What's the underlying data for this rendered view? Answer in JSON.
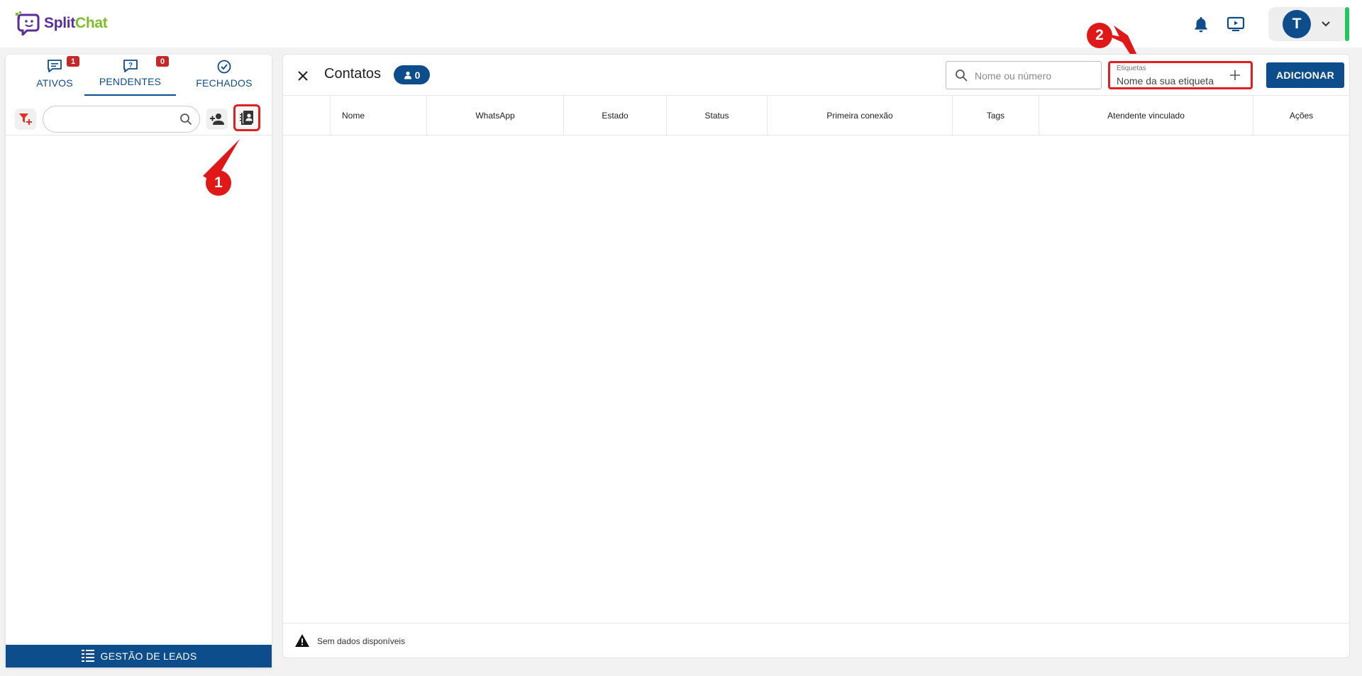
{
  "app": {
    "logo_split": "Split",
    "logo_chat": "Chat"
  },
  "header": {
    "user_initial": "T"
  },
  "sidebar": {
    "tabs": [
      {
        "label": "ATIVOS",
        "badge": "1"
      },
      {
        "label": "PENDENTES",
        "badge": "0"
      },
      {
        "label": "FECHADOS"
      }
    ],
    "leads_label": "GESTÃO DE LEADS"
  },
  "markers": {
    "one": "1",
    "two": "2"
  },
  "contacts": {
    "title": "Contatos",
    "count": "0",
    "search_placeholder": "Nome ou número",
    "tag_label": "Etiquetas",
    "tag_placeholder": "Nome da sua etiqueta",
    "add_label": "ADICIONAR",
    "columns": [
      "Nome",
      "WhatsApp",
      "Estado",
      "Status",
      "Primeira conexão",
      "Tags",
      "Atendente vinculado",
      "Ações"
    ],
    "empty_text": "Sem dados disponíveis"
  },
  "colors": {
    "primary": "#0d4d8b",
    "badge": "#c62828",
    "highlight": "#e02020",
    "online": "#22c55e"
  }
}
